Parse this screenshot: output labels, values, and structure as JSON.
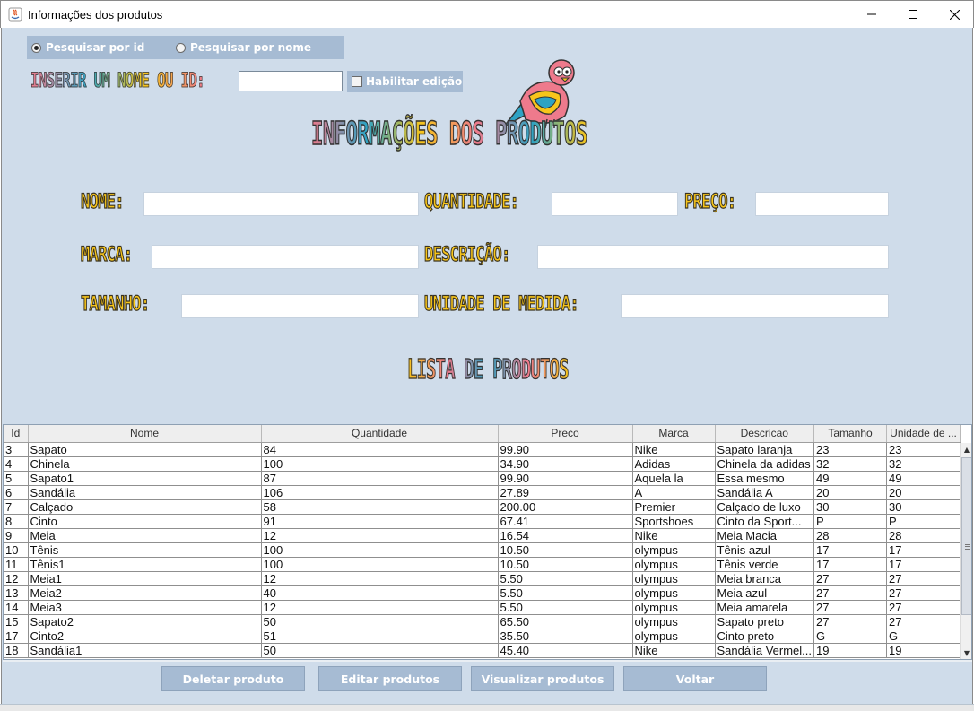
{
  "window": {
    "title": "Informações dos produtos",
    "controls": {
      "minimize": "—",
      "maximize": "☐",
      "close": "✕"
    }
  },
  "search": {
    "option_id": "Pesquisar por id",
    "option_name": "Pesquisar por nome",
    "selected": "id",
    "insert_label": "INSERIR UM NOME OU ID:",
    "input_value": "",
    "edit_label": "Habilitar edição",
    "edit_checked": false
  },
  "header": {
    "title": "INFORMAÇÕES DOS PRODUTOS",
    "mascot": "bird-mascot-icon"
  },
  "form": {
    "nome_label": "NOME:",
    "quantidade_label": "QUANTIDADE:",
    "preco_label": "PREÇO:",
    "marca_label": "MARCA:",
    "descricao_label": "DESCRIÇÃO:",
    "tamanho_label": "TAMANHO:",
    "unidade_label": "UNIDADE DE MEDIDA:",
    "nome_value": "",
    "quantidade_value": "",
    "preco_value": "",
    "marca_value": "",
    "descricao_value": "",
    "tamanho_value": "",
    "unidade_value": ""
  },
  "list_title": "LISTA DE PRODUTOS",
  "table": {
    "columns": [
      "Id",
      "Nome",
      "Quantidade",
      "Preco",
      "Marca",
      "Descricao",
      "Tamanho",
      "Unidade de ..."
    ],
    "rows": [
      [
        "3",
        "Sapato",
        "84",
        "99.90",
        "Nike",
        "Sapato laranja",
        "23",
        "23"
      ],
      [
        "4",
        "Chinela",
        "100",
        "34.90",
        "Adidas",
        "Chinela da adidas",
        "32",
        "32"
      ],
      [
        "5",
        "Sapato1",
        "87",
        "99.90",
        "Aquela la",
        "Essa mesmo",
        "49",
        "49"
      ],
      [
        "6",
        "Sandália",
        "106",
        "27.89",
        "A",
        "Sandália A",
        "20",
        "20"
      ],
      [
        "7",
        "Calçado",
        "58",
        "200.00",
        "Premier",
        "Calçado de luxo",
        "30",
        "30"
      ],
      [
        "8",
        "Cinto",
        "91",
        "67.41",
        "Sportshoes",
        "Cinto da Sport...",
        "P",
        "P"
      ],
      [
        "9",
        "Meia",
        "12",
        "16.54",
        "Nike",
        "Meia Macia",
        "28",
        "28"
      ],
      [
        "10",
        "Tênis",
        "100",
        "10.50",
        "olympus",
        "Tênis azul",
        "17",
        "17"
      ],
      [
        "11",
        "Tênis1",
        "100",
        "10.50",
        "olympus",
        "Tênis verde",
        "17",
        "17"
      ],
      [
        "12",
        "Meia1",
        "12",
        "5.50",
        "olympus",
        "Meia branca",
        "27",
        "27"
      ],
      [
        "13",
        "Meia2",
        "40",
        "5.50",
        "olympus",
        "Meia azul",
        "27",
        "27"
      ],
      [
        "14",
        "Meia3",
        "12",
        "5.50",
        "olympus",
        "Meia amarela",
        "27",
        "27"
      ],
      [
        "15",
        "Sapato2",
        "50",
        "65.50",
        "olympus",
        "Sapato preto",
        "27",
        "27"
      ],
      [
        "17",
        "Cinto2",
        "51",
        "35.50",
        "olympus",
        "Cinto preto",
        "G",
        "G"
      ],
      [
        "18",
        "Sandália1",
        "50",
        "45.40",
        "Nike",
        "Sandália Vermel...",
        "19",
        "19"
      ]
    ]
  },
  "buttons": {
    "delete": "Deletar produto",
    "edit": "Editar produtos",
    "view": "Visualizar produtos",
    "back": "Voltar"
  },
  "colors": {
    "background": "#cfdcea",
    "panel": "#a6bbd3",
    "label_yellow": "#f7c51b",
    "title_pink": "#ee7a8c",
    "title_teal": "#2fa3c4",
    "title_yellow": "#f7c51b"
  }
}
